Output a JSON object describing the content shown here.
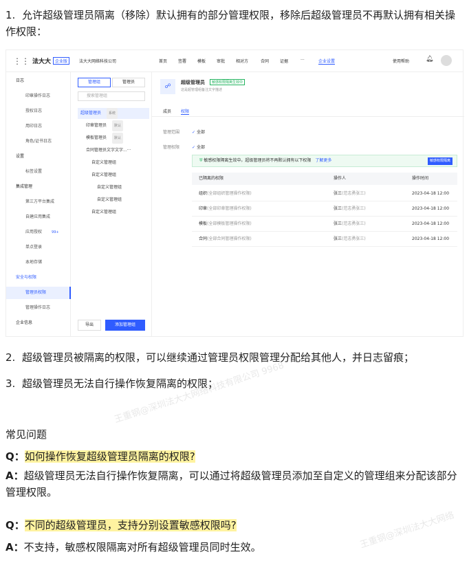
{
  "doc": {
    "item1_num": "1.",
    "item1": "允许超级管理员隔离（移除）默认拥有的部分管理权限，移除后超级管理员不再默认拥有相关操作权限：",
    "item2_num": "2.",
    "item2": "超级管理员被隔离的权限，可以继续通过管理员权限管理分配给其他人，并日志留痕；",
    "item3_num": "3.",
    "item3": "超级管理员无法自行操作恢复隔离的权限；",
    "faq_title": "常见问题",
    "q1_label": "Q：",
    "q1": "如何操作恢复超级管理员隔离的权限?",
    "a1_label": "A：",
    "a1": "超级管理员无法自行操作恢复隔离，可以通过将超级管理员添加至自定义的管理组来分配该部分管理权限。",
    "q2_label": "Q：",
    "q2": "不同的超级管理员，支持分别设置敏感权限吗?",
    "a2_label": "A：",
    "a2": "不支持，敏感权限隔离对所有超级管理员同时生效。"
  },
  "watermarks": [
    "王重钢@深圳法大大网络科技有限公司 9968",
    "王重钢@深圳法大大网络"
  ],
  "topbar": {
    "logo": "法大大",
    "logo_badge": "企业版",
    "company": "法大大网络科技公司",
    "nav": [
      "首页",
      "签署",
      "模板",
      "审批",
      "相对方",
      "合同",
      "证据",
      "···",
      "企业设置"
    ],
    "active_nav": "企业设置",
    "help": "使用帮助"
  },
  "sidebar": {
    "items": [
      {
        "label": "日志",
        "type": "sec",
        "caret": "^"
      },
      {
        "label": "印章操作日志",
        "type": "sub"
      },
      {
        "label": "授权日志",
        "type": "sub"
      },
      {
        "label": "用印日志",
        "type": "sub"
      },
      {
        "label": "角色/证书日志",
        "type": "sub"
      },
      {
        "label": "设置",
        "type": "sec",
        "caret": "^"
      },
      {
        "label": "标签设置",
        "type": "sub"
      },
      {
        "label": "集成管理",
        "type": "sec",
        "caret": "^"
      },
      {
        "label": "第三方平台集成",
        "type": "sub"
      },
      {
        "label": "自建应用集成",
        "type": "sub"
      },
      {
        "label": "应用授权",
        "type": "sub",
        "badge": "99+"
      },
      {
        "label": "单点登录",
        "type": "sub"
      },
      {
        "label": "本地存储",
        "type": "sub"
      },
      {
        "label": "安全与权限",
        "type": "sec",
        "caret": "^"
      },
      {
        "label": "管理员权限",
        "type": "sub",
        "active": true
      },
      {
        "label": "管理操作日志",
        "type": "sub"
      },
      {
        "label": "企业信息",
        "type": "sec"
      }
    ]
  },
  "groups": {
    "tab_active": "管理组",
    "tab_other": "管理员",
    "search_placeholder": "搜索管理组",
    "export": "导出",
    "add": "添加管理组",
    "tree": [
      {
        "label": "超级管理员",
        "tag": "系统",
        "level": 0,
        "selected": true
      },
      {
        "label": "印章管理员",
        "tag": "默认",
        "level": 1
      },
      {
        "label": "模板管理员",
        "tag": "默认",
        "level": 1
      },
      {
        "label": "合同管理员文字文字...",
        "tag": "···",
        "level": 1
      },
      {
        "label": "自定义管理组",
        "tag": "",
        "level": 2
      },
      {
        "label": "自定义管理组",
        "tag": "",
        "level": 2
      },
      {
        "label": "自定义管理组",
        "tag": "",
        "level": 3
      },
      {
        "label": "自定义管理组",
        "tag": "",
        "level": 3
      },
      {
        "label": "自定义管理组",
        "tag": "",
        "level": 2
      }
    ]
  },
  "detail": {
    "title": "超级管理员",
    "badge": "敏感权限隔离生效中",
    "desc": "这是超管理组备注文字描述",
    "tabs": [
      "成员",
      "权限"
    ],
    "active_tab": "权限",
    "scope_label": "管理范围",
    "scope_value": "全部",
    "perm_label": "管理权限",
    "perm_value": "全部",
    "banner": "敏感权限隔离生效中。超级管理员将不再默认拥有以下权限",
    "banner_link": "了解更多",
    "banner_btn": "敏感权限隔离",
    "table": {
      "headers": [
        "已隔离的权限",
        "操作人",
        "操作时间"
      ],
      "rows": [
        {
          "perm": "组织",
          "perm_note": "(全部组织管理操作权限)",
          "op": "张三",
          "op_note": "(范志勇张三)",
          "time": "2023-04-18 12:00"
        },
        {
          "perm": "印章",
          "perm_note": "(全部印章管理操作权限)",
          "op": "张三",
          "op_note": "(范志勇张三)",
          "time": "2023-04-18 12:00"
        },
        {
          "perm": "模板",
          "perm_note": "(全部模板管理操作权限)",
          "op": "张三",
          "op_note": "(范志勇张三)",
          "time": "2023-04-18 12:00"
        },
        {
          "perm": "合同",
          "perm_note": "(全部合同管理操作权限)",
          "op": "张三",
          "op_note": "(范志勇张三)",
          "time": "2023-04-18 12:00"
        }
      ]
    }
  },
  "colors": {
    "accent": "#2f5cff",
    "highlight": "#fff3a0",
    "success": "#22b35e"
  }
}
